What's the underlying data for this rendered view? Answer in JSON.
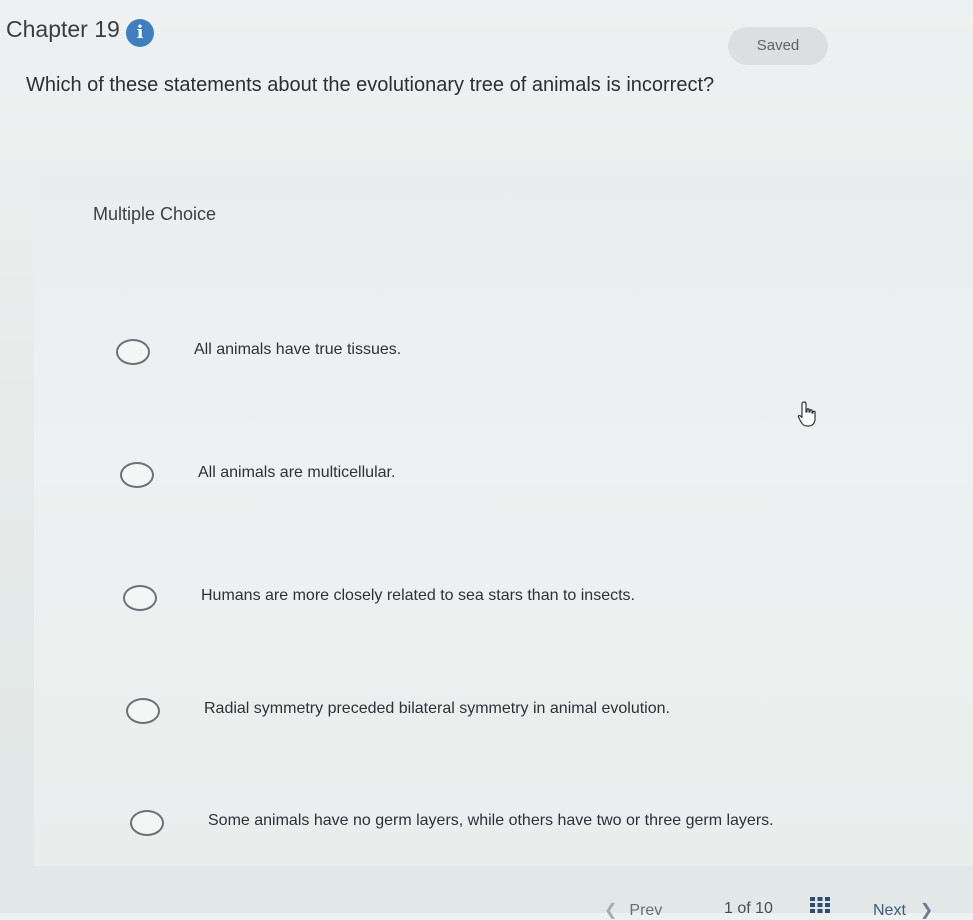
{
  "header": {
    "chapter_title": "Chapter 19",
    "info_glyph": "i",
    "saved_label": "Saved"
  },
  "question": {
    "text": "Which of these statements about the evolutionary tree of animals is incorrect?"
  },
  "multiple_choice": {
    "label": "Multiple Choice",
    "options": [
      {
        "text": "All animals have true tissues.",
        "selected": false
      },
      {
        "text": "All animals are multicellular.",
        "selected": false
      },
      {
        "text": "Humans are more closely related to sea stars than to insects.",
        "selected": false
      },
      {
        "text": "Radial symmetry preceded bilateral symmetry in animal evolution.",
        "selected": false
      },
      {
        "text": "Some animals have no germ layers, while others have two or three germ layers.",
        "selected": false
      }
    ]
  },
  "footer": {
    "prev_arrow": "❮",
    "prev_label": "Prev",
    "page_indicator": "1 of 10",
    "next_label": "Next",
    "next_arrow": "❯"
  },
  "colors": {
    "info_icon": "#3e7fc0",
    "saved_badge_bg": "#dcdfe0",
    "radio_border": "#6d7176"
  },
  "icons": {
    "info": "info-icon",
    "cursor": "hand-pointer-icon",
    "grid": "grid-icon"
  }
}
